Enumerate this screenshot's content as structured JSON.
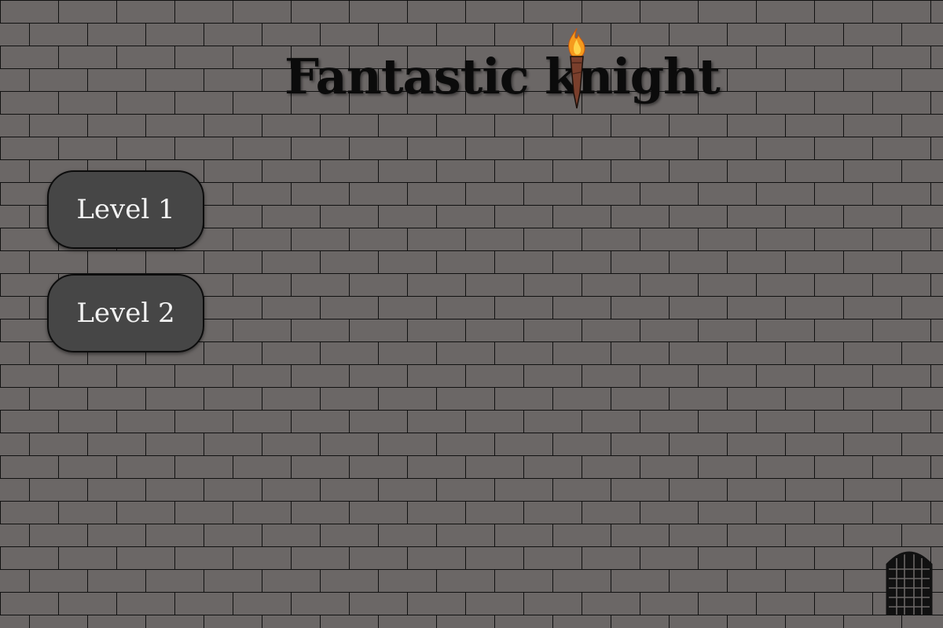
{
  "game": {
    "title": "Fantastic knight"
  },
  "menu": {
    "levels": [
      {
        "label": "Level 1"
      },
      {
        "label": "Level 2"
      }
    ]
  },
  "icons": {
    "title_decoration": "torch-icon",
    "exit": "castle-gate-icon"
  },
  "colors": {
    "wall": "#6b6766",
    "mortar": "#111111",
    "button_fill": "#464646",
    "button_text": "#f2f2f2",
    "title": "#0b0b0b",
    "flame": "#f59a1d"
  }
}
